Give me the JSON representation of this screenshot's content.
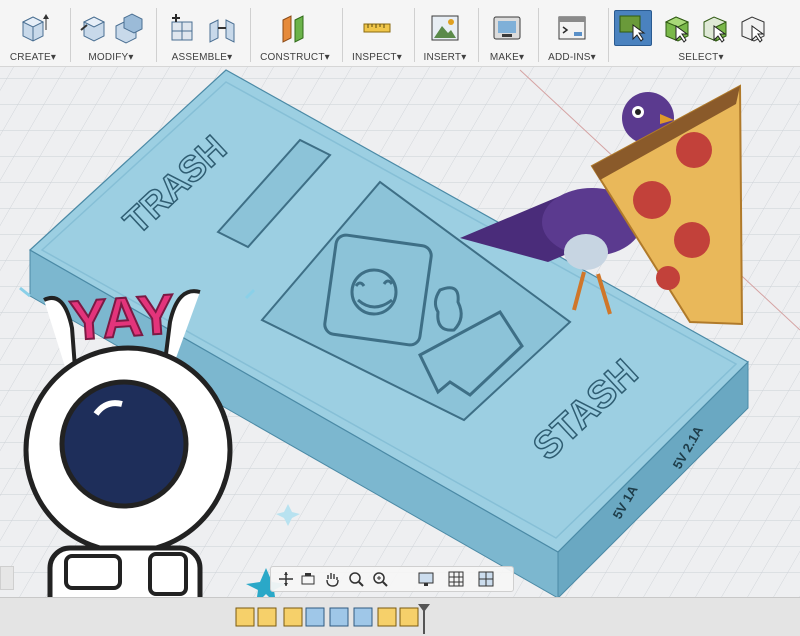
{
  "toolbar": {
    "groups": {
      "create": "CREATE",
      "modify": "MODIFY",
      "assemble": "ASSEMBLE",
      "construct": "CONSTRUCT",
      "inspect": "INSPECT",
      "insert": "INSERT",
      "make": "MAKE",
      "addins": "ADD-INS",
      "select": "SELECT"
    },
    "dropdown_glyph": "▾"
  },
  "model": {
    "engraving_left": "TRASH",
    "engraving_right": "STASH",
    "port_left": "5V 1A",
    "port_right": "5V 2.1A"
  },
  "stickers": {
    "astronaut_text": "YAY"
  },
  "colors": {
    "model_top": "#98cde0",
    "model_side": "#7ab6cf",
    "accent_select": "#2f6fae",
    "yay_pink": "#e3347b"
  }
}
